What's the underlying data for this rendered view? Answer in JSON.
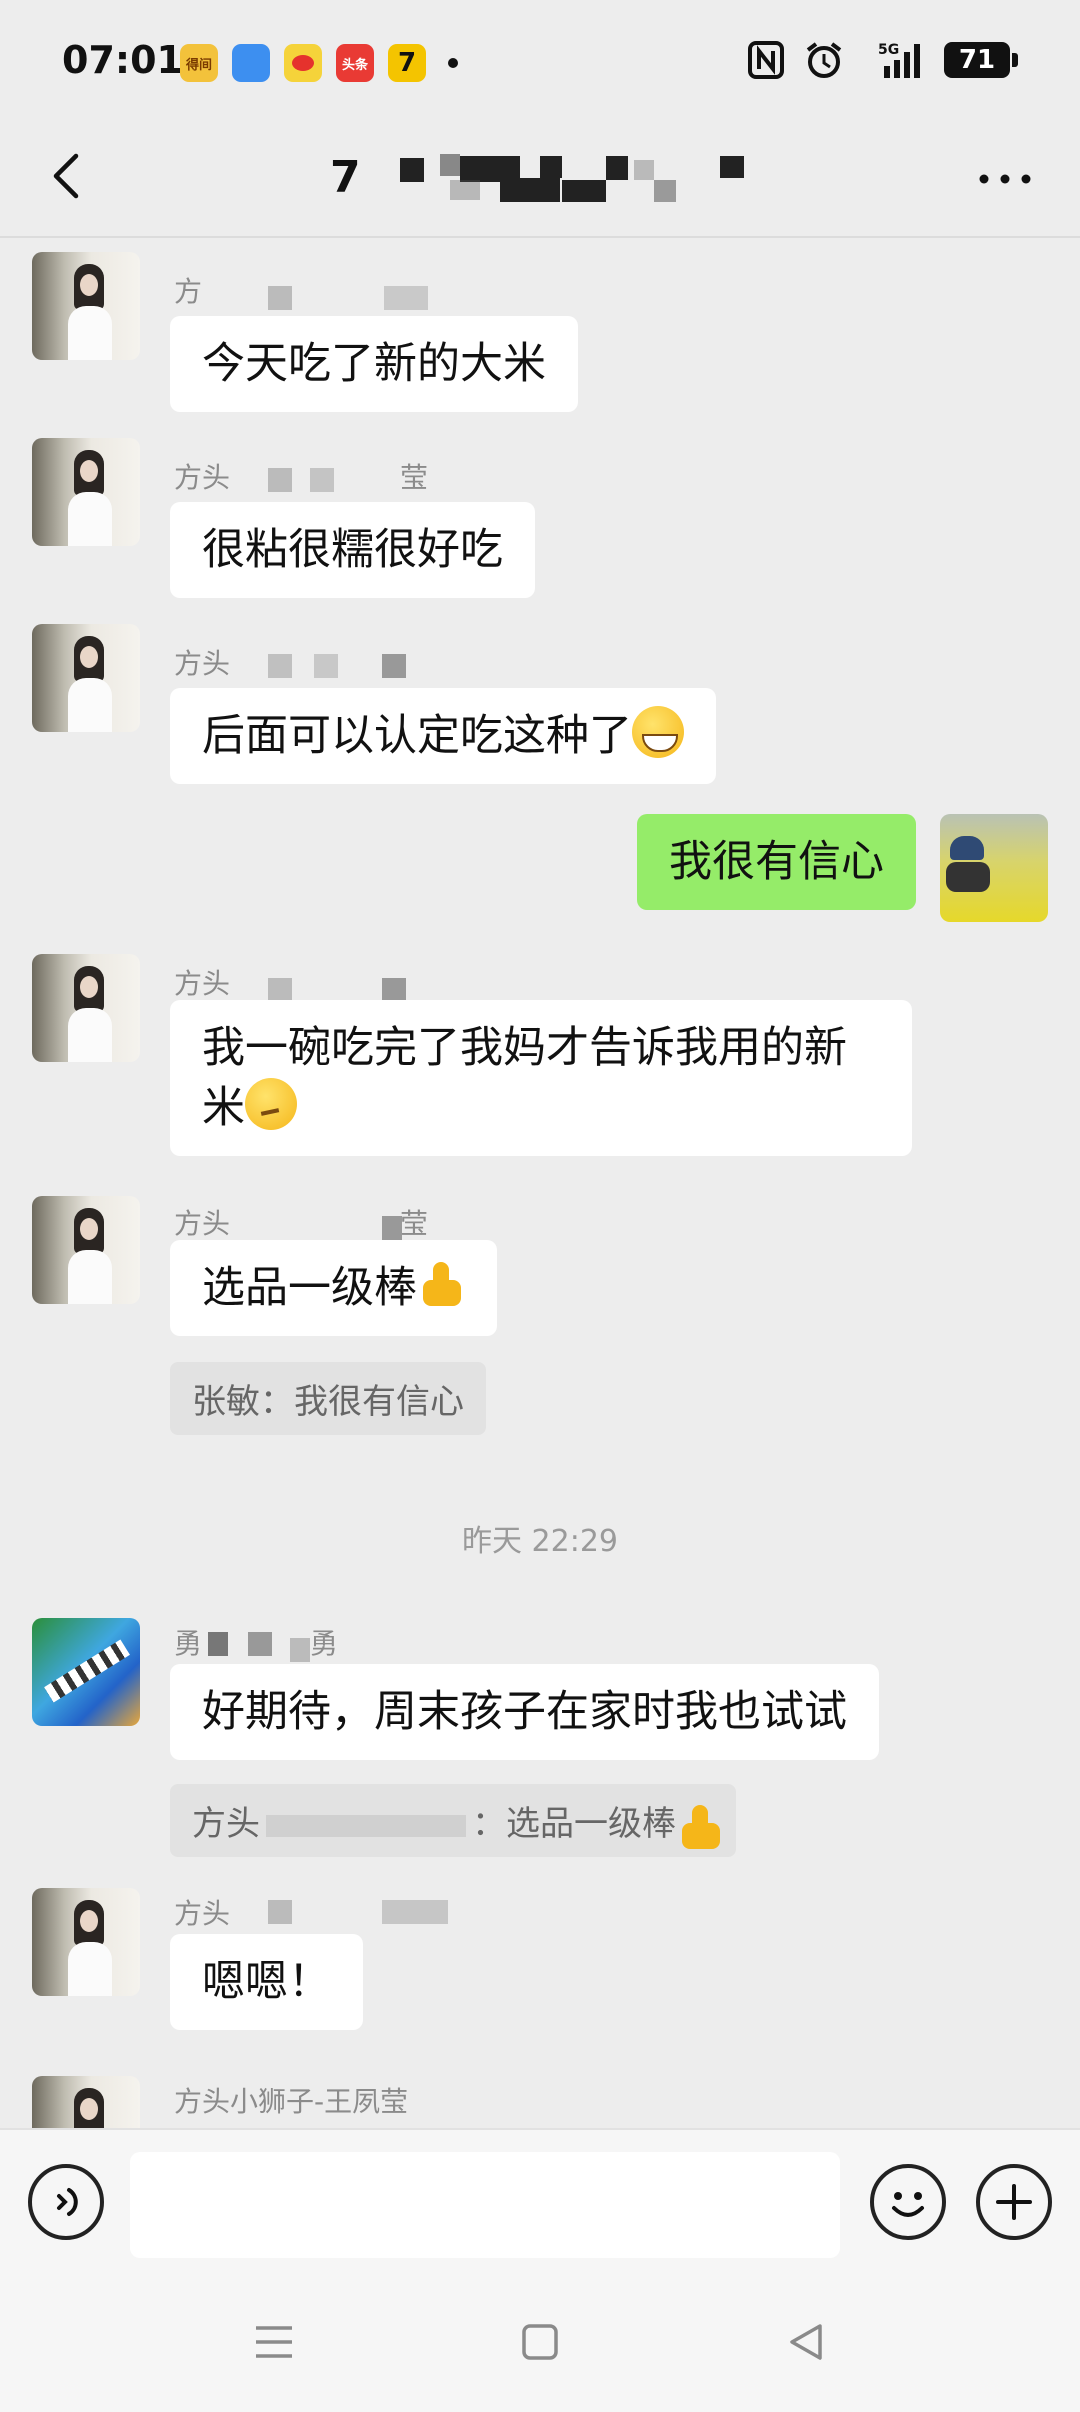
{
  "status_bar": {
    "time": "07:01",
    "app_icons": [
      "得间",
      "",
      "",
      "头条",
      "7"
    ],
    "signal": "5G",
    "battery": "71"
  },
  "title_bar": {
    "title": "7"
  },
  "messages": [
    {
      "sender": "方",
      "text": "今天吃了新的大米"
    },
    {
      "sender": "方头",
      "text": "很粘很糯很好吃",
      "sender_suffix": "莹"
    },
    {
      "sender": "方头",
      "text": "后面可以认定吃这种了"
    },
    {
      "mine": true,
      "text": "我很有信心"
    },
    {
      "sender": "方头",
      "text": "我一碗吃完了我妈才告诉我用的新米"
    },
    {
      "sender": "方头",
      "sender_suffix": "莹",
      "text": "选品一级棒",
      "quote": "张敏：我很有信心"
    },
    {
      "timestamp": "昨天 22:29"
    },
    {
      "sender": "勇",
      "sender_suffix": "勇",
      "text": "好期待，周末孩子在家时我也试试",
      "quote_prefix": "方头",
      "quote_text": "：选品一级棒"
    },
    {
      "sender": "方头",
      "text": "嗯嗯！"
    },
    {
      "sender": "方头小狮子-王夙莹",
      "text": ""
    }
  ],
  "input": {
    "placeholder": ""
  }
}
